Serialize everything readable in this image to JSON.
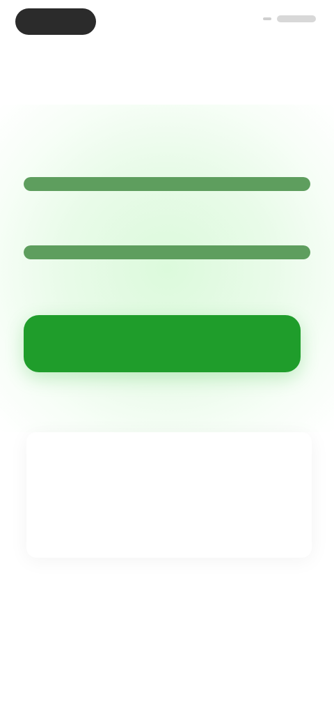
{
  "status_bar": {
    "time": "",
    "indicators": ""
  },
  "headline": {
    "line1": "",
    "line2": ""
  },
  "progress": [
    {
      "label": "",
      "value_text": "",
      "fill": 1.0
    },
    {
      "label": "",
      "value_text": "",
      "fill": 1.0
    }
  ],
  "note": "",
  "primary_button": {
    "label": ""
  },
  "info_card": {
    "label": "",
    "text": "",
    "link": ""
  },
  "colors": {
    "accent": "#1f9d2b",
    "progress_fill": "#5e9e5e",
    "progress_track": "#cde6cd",
    "card_label": "#e3bf9c"
  }
}
